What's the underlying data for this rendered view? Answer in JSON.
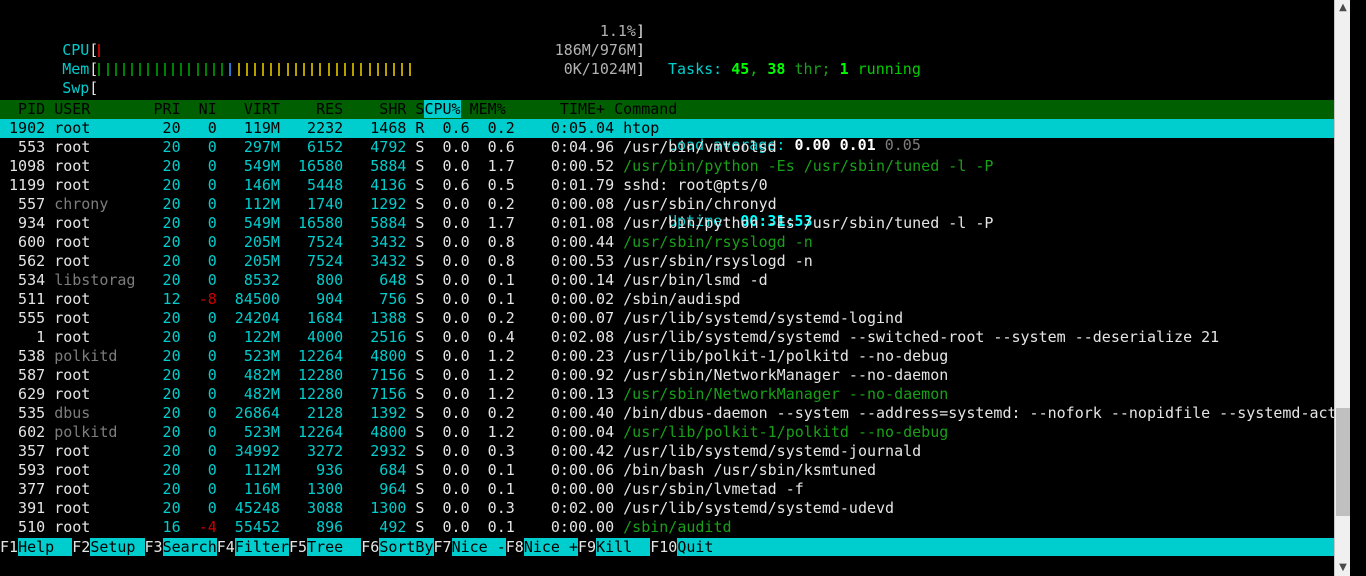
{
  "window": {
    "title": "htop"
  },
  "meters": {
    "cpu": {
      "label": "CPU",
      "open": "[",
      "close": "]",
      "value": "1.1%",
      "bars": [
        {
          "color": "red",
          "n": 1
        }
      ],
      "total_cells": 40
    },
    "mem": {
      "label": "Mem",
      "open": "[",
      "close": "]",
      "value": "186M/976M",
      "bars": [
        {
          "color": "green",
          "n": 16
        },
        {
          "color": "blue",
          "n": 1
        },
        {
          "color": "olive",
          "n": 22
        }
      ],
      "total_cells": 40
    },
    "swp": {
      "label": "Swp",
      "open": "[",
      "close": "]",
      "value": "0K/1024M",
      "bars": [],
      "total_cells": 40
    }
  },
  "header_right": {
    "tasks": {
      "label": "Tasks:",
      "count": "45",
      "sep": ",",
      "threads": "38",
      "thr_label": "thr;",
      "running": "1",
      "running_label": "running"
    },
    "load": {
      "label": "Load average:",
      "v1": "0.00",
      "v2": "0.01",
      "v3": "0.05"
    },
    "uptime": {
      "label": "Uptime:",
      "value": "00:31:53"
    }
  },
  "columns": {
    "headers": [
      "PID",
      "USER",
      "PRI",
      "NI",
      "VIRT",
      "RES",
      "SHR",
      "S",
      "CPU%",
      "MEM%",
      "TIME+",
      "Command"
    ],
    "sort_column": "CPU%"
  },
  "processes": [
    {
      "pid": "1902",
      "user": "root",
      "user_dim": false,
      "pri": "20",
      "ni": "0",
      "ni_neg": false,
      "virt": "119M",
      "res": "2232",
      "shr": "1468",
      "s": "R",
      "cpu": "0.6",
      "mem": "0.2",
      "time": "0:05.04",
      "command": "htop",
      "thread": false,
      "selected": true
    },
    {
      "pid": "553",
      "user": "root",
      "user_dim": false,
      "pri": "20",
      "ni": "0",
      "ni_neg": false,
      "virt": "297M",
      "res": "6152",
      "shr": "4792",
      "s": "S",
      "cpu": "0.0",
      "mem": "0.6",
      "time": "0:04.96",
      "command": "/usr/bin/vmtoolsd",
      "thread": false,
      "selected": false
    },
    {
      "pid": "1098",
      "user": "root",
      "user_dim": false,
      "pri": "20",
      "ni": "0",
      "ni_neg": false,
      "virt": "549M",
      "res": "16580",
      "shr": "5884",
      "s": "S",
      "cpu": "0.0",
      "mem": "1.7",
      "time": "0:00.52",
      "command": "/usr/bin/python -Es /usr/sbin/tuned -l -P",
      "thread": true,
      "selected": false
    },
    {
      "pid": "1199",
      "user": "root",
      "user_dim": false,
      "pri": "20",
      "ni": "0",
      "ni_neg": false,
      "virt": "146M",
      "res": "5448",
      "shr": "4136",
      "s": "S",
      "cpu": "0.6",
      "mem": "0.5",
      "time": "0:01.79",
      "command": "sshd: root@pts/0",
      "thread": false,
      "selected": false
    },
    {
      "pid": "557",
      "user": "chrony",
      "user_dim": true,
      "pri": "20",
      "ni": "0",
      "ni_neg": false,
      "virt": "112M",
      "res": "1740",
      "shr": "1292",
      "s": "S",
      "cpu": "0.0",
      "mem": "0.2",
      "time": "0:00.08",
      "command": "/usr/sbin/chronyd",
      "thread": false,
      "selected": false
    },
    {
      "pid": "934",
      "user": "root",
      "user_dim": false,
      "pri": "20",
      "ni": "0",
      "ni_neg": false,
      "virt": "549M",
      "res": "16580",
      "shr": "5884",
      "s": "S",
      "cpu": "0.0",
      "mem": "1.7",
      "time": "0:01.08",
      "command": "/usr/bin/python -Es /usr/sbin/tuned -l -P",
      "thread": false,
      "selected": false
    },
    {
      "pid": "600",
      "user": "root",
      "user_dim": false,
      "pri": "20",
      "ni": "0",
      "ni_neg": false,
      "virt": "205M",
      "res": "7524",
      "shr": "3432",
      "s": "S",
      "cpu": "0.0",
      "mem": "0.8",
      "time": "0:00.44",
      "command": "/usr/sbin/rsyslogd -n",
      "thread": true,
      "selected": false
    },
    {
      "pid": "562",
      "user": "root",
      "user_dim": false,
      "pri": "20",
      "ni": "0",
      "ni_neg": false,
      "virt": "205M",
      "res": "7524",
      "shr": "3432",
      "s": "S",
      "cpu": "0.0",
      "mem": "0.8",
      "time": "0:00.53",
      "command": "/usr/sbin/rsyslogd -n",
      "thread": false,
      "selected": false
    },
    {
      "pid": "534",
      "user": "libstorag",
      "user_dim": true,
      "pri": "20",
      "ni": "0",
      "ni_neg": false,
      "virt": "8532",
      "res": "800",
      "shr": "648",
      "s": "S",
      "cpu": "0.0",
      "mem": "0.1",
      "time": "0:00.14",
      "command": "/usr/bin/lsmd -d",
      "thread": false,
      "selected": false
    },
    {
      "pid": "511",
      "user": "root",
      "user_dim": false,
      "pri": "12",
      "ni": "-8",
      "ni_neg": true,
      "virt": "84500",
      "res": "904",
      "shr": "756",
      "s": "S",
      "cpu": "0.0",
      "mem": "0.1",
      "time": "0:00.02",
      "command": "/sbin/audispd",
      "thread": false,
      "selected": false
    },
    {
      "pid": "555",
      "user": "root",
      "user_dim": false,
      "pri": "20",
      "ni": "0",
      "ni_neg": false,
      "virt": "24204",
      "res": "1684",
      "shr": "1388",
      "s": "S",
      "cpu": "0.0",
      "mem": "0.2",
      "time": "0:00.07",
      "command": "/usr/lib/systemd/systemd-logind",
      "thread": false,
      "selected": false
    },
    {
      "pid": "1",
      "user": "root",
      "user_dim": false,
      "pri": "20",
      "ni": "0",
      "ni_neg": false,
      "virt": "122M",
      "res": "4000",
      "shr": "2516",
      "s": "S",
      "cpu": "0.0",
      "mem": "0.4",
      "time": "0:02.08",
      "command": "/usr/lib/systemd/systemd --switched-root --system --deserialize 21",
      "thread": false,
      "selected": false
    },
    {
      "pid": "538",
      "user": "polkitd",
      "user_dim": true,
      "pri": "20",
      "ni": "0",
      "ni_neg": false,
      "virt": "523M",
      "res": "12264",
      "shr": "4800",
      "s": "S",
      "cpu": "0.0",
      "mem": "1.2",
      "time": "0:00.23",
      "command": "/usr/lib/polkit-1/polkitd --no-debug",
      "thread": false,
      "selected": false
    },
    {
      "pid": "587",
      "user": "root",
      "user_dim": false,
      "pri": "20",
      "ni": "0",
      "ni_neg": false,
      "virt": "482M",
      "res": "12280",
      "shr": "7156",
      "s": "S",
      "cpu": "0.0",
      "mem": "1.2",
      "time": "0:00.92",
      "command": "/usr/sbin/NetworkManager --no-daemon",
      "thread": false,
      "selected": false
    },
    {
      "pid": "629",
      "user": "root",
      "user_dim": false,
      "pri": "20",
      "ni": "0",
      "ni_neg": false,
      "virt": "482M",
      "res": "12280",
      "shr": "7156",
      "s": "S",
      "cpu": "0.0",
      "mem": "1.2",
      "time": "0:00.13",
      "command": "/usr/sbin/NetworkManager --no-daemon",
      "thread": true,
      "selected": false
    },
    {
      "pid": "535",
      "user": "dbus",
      "user_dim": true,
      "pri": "20",
      "ni": "0",
      "ni_neg": false,
      "virt": "26864",
      "res": "2128",
      "shr": "1392",
      "s": "S",
      "cpu": "0.0",
      "mem": "0.2",
      "time": "0:00.40",
      "command": "/bin/dbus-daemon --system --address=systemd: --nofork --nopidfile --systemd-activati",
      "thread": false,
      "selected": false
    },
    {
      "pid": "602",
      "user": "polkitd",
      "user_dim": true,
      "pri": "20",
      "ni": "0",
      "ni_neg": false,
      "virt": "523M",
      "res": "12264",
      "shr": "4800",
      "s": "S",
      "cpu": "0.0",
      "mem": "1.2",
      "time": "0:00.04",
      "command": "/usr/lib/polkit-1/polkitd --no-debug",
      "thread": true,
      "selected": false
    },
    {
      "pid": "357",
      "user": "root",
      "user_dim": false,
      "pri": "20",
      "ni": "0",
      "ni_neg": false,
      "virt": "34992",
      "res": "3272",
      "shr": "2932",
      "s": "S",
      "cpu": "0.0",
      "mem": "0.3",
      "time": "0:00.42",
      "command": "/usr/lib/systemd/systemd-journald",
      "thread": false,
      "selected": false
    },
    {
      "pid": "593",
      "user": "root",
      "user_dim": false,
      "pri": "20",
      "ni": "0",
      "ni_neg": false,
      "virt": "112M",
      "res": "936",
      "shr": "684",
      "s": "S",
      "cpu": "0.0",
      "mem": "0.1",
      "time": "0:00.06",
      "command": "/bin/bash /usr/sbin/ksmtuned",
      "thread": false,
      "selected": false
    },
    {
      "pid": "377",
      "user": "root",
      "user_dim": false,
      "pri": "20",
      "ni": "0",
      "ni_neg": false,
      "virt": "116M",
      "res": "1300",
      "shr": "964",
      "s": "S",
      "cpu": "0.0",
      "mem": "0.1",
      "time": "0:00.00",
      "command": "/usr/sbin/lvmetad -f",
      "thread": false,
      "selected": false
    },
    {
      "pid": "391",
      "user": "root",
      "user_dim": false,
      "pri": "20",
      "ni": "0",
      "ni_neg": false,
      "virt": "45248",
      "res": "3088",
      "shr": "1300",
      "s": "S",
      "cpu": "0.0",
      "mem": "0.3",
      "time": "0:02.00",
      "command": "/usr/lib/systemd/systemd-udevd",
      "thread": false,
      "selected": false
    },
    {
      "pid": "510",
      "user": "root",
      "user_dim": false,
      "pri": "16",
      "ni": "-4",
      "ni_neg": true,
      "virt": "55452",
      "res": "896",
      "shr": "492",
      "s": "S",
      "cpu": "0.0",
      "mem": "0.1",
      "time": "0:00.00",
      "command": "/sbin/auditd",
      "thread": true,
      "selected": false
    }
  ],
  "function_keys": [
    {
      "key": "F1",
      "label": "Help  "
    },
    {
      "key": "F2",
      "label": "Setup "
    },
    {
      "key": "F3",
      "label": "Search"
    },
    {
      "key": "F4",
      "label": "Filter"
    },
    {
      "key": "F5",
      "label": "Tree  "
    },
    {
      "key": "F6",
      "label": "SortBy"
    },
    {
      "key": "F7",
      "label": "Nice -"
    },
    {
      "key": "F8",
      "label": "Nice +"
    },
    {
      "key": "F9",
      "label": "Kill  "
    },
    {
      "key": "F10",
      "label": "Quit  "
    }
  ],
  "scrollbar": {
    "up_arrow": "▲",
    "down_arrow": "▼",
    "thumb_top_pct": 72,
    "thumb_height_pct": 20
  }
}
